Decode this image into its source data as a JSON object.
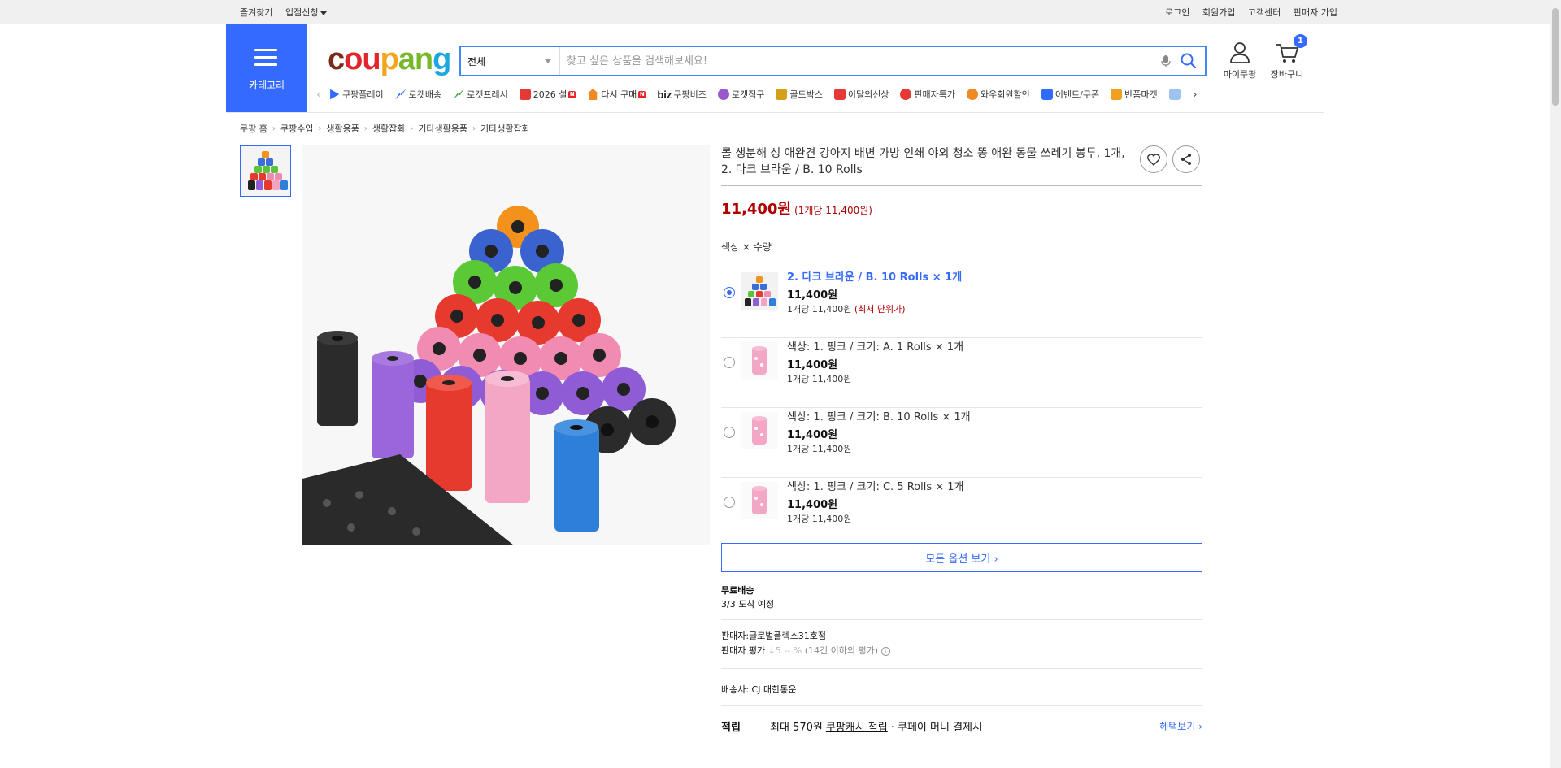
{
  "topbar": {
    "left": [
      "즐겨찾기",
      "입점신청"
    ],
    "right": [
      "로그인",
      "회원가입",
      "고객센터",
      "판매자 가입"
    ]
  },
  "header": {
    "category_label": "카테고리",
    "logo_parts": [
      "c",
      "ou",
      "p",
      "an",
      "g"
    ],
    "search_select": "전체",
    "search_placeholder": "찾고 싶은 상품을 검색해보세요!",
    "my_label": "마이쿠팡",
    "cart_label": "장바구니",
    "cart_count": "1"
  },
  "nav": {
    "items": [
      {
        "label": "쿠팡플레이",
        "icon": "play-icon",
        "color": "#2f6bff"
      },
      {
        "label": "로켓배송",
        "icon": "rocket-icon",
        "color": "#2f6bff"
      },
      {
        "label": "로켓프레시",
        "icon": "rocket-fresh-icon",
        "color": "#3daa3d"
      },
      {
        "label": "2026 설",
        "icon": "gift-icon",
        "color": "#e53935"
      },
      {
        "label": "다시 구매",
        "icon": "rebuy-icon",
        "color": "#f08a24"
      },
      {
        "label": "쿠팡비즈",
        "icon": "biz-icon",
        "color": "#111111"
      },
      {
        "label": "로켓직구",
        "icon": "globe-icon",
        "color": "#9b59d0"
      },
      {
        "label": "골드박스",
        "icon": "gold-box-icon",
        "color": "#d4a017"
      },
      {
        "label": "이달의신상",
        "icon": "new-icon",
        "color": "#e53935"
      },
      {
        "label": "판매자특가",
        "icon": "percent-icon",
        "color": "#e53935"
      },
      {
        "label": "와우회원할인",
        "icon": "wow-icon",
        "color": "#f08a24"
      },
      {
        "label": "이벤트/쿠폰",
        "icon": "coupon-icon",
        "color": "#2f6bff"
      },
      {
        "label": "반품마켓",
        "icon": "market-icon",
        "color": "#f0a020"
      }
    ],
    "biz_prefix": "biz",
    "badge": "N"
  },
  "breadcrumb": [
    "쿠팡 홈",
    "쿠팡수입",
    "생활용품",
    "생활잡화",
    "기타생활용품",
    "기타생활잡화"
  ],
  "product": {
    "title": "롤 생분해 성 애완견 강아지 배변 가방 인쇄 야외 청소 똥 애완 동물 쓰레기 봉투, 1개, 2. 다크 브라운 / B. 10 Rolls",
    "price": "11,400원",
    "unit_price": "(1개당 11,400원)",
    "option_label": "색상 × 수량",
    "options": [
      {
        "name": "2. 다크 브라운 / B. 10 Rolls × 1개",
        "price": "11,400원",
        "unit": "1개당 11,400원",
        "low": "(최저 단위가)",
        "selected": true
      },
      {
        "name": "색상: 1. 핑크 / 크기: A. 1 Rolls × 1개",
        "price": "11,400원",
        "unit": "1개당 11,400원",
        "low": "",
        "selected": false
      },
      {
        "name": "색상: 1. 핑크 / 크기: B. 10 Rolls × 1개",
        "price": "11,400원",
        "unit": "1개당 11,400원",
        "low": "",
        "selected": false
      },
      {
        "name": "색상: 1. 핑크 / 크기: C. 5 Rolls × 1개",
        "price": "11,400원",
        "unit": "1개당 11,400원",
        "low": "",
        "selected": false
      }
    ],
    "all_options": "모든 옵션 보기 ›",
    "shipping": "무료배송",
    "arrival": "3/3 도착 예정",
    "seller": "판매자:글로벌플렉스31호점",
    "seller_rating_label": "판매자 평가",
    "seller_rating_value": "↓5 -- %",
    "seller_rating_note": "(14건 이하의 평가)",
    "carrier": "배송사:  CJ 대한통운",
    "points_label": "적립",
    "points_max": "최대 570원",
    "points_link": "쿠팡캐시 적립",
    "points_suffix": "· 쿠페이 머니 결제시",
    "benefit": "혜택보기 ›"
  }
}
